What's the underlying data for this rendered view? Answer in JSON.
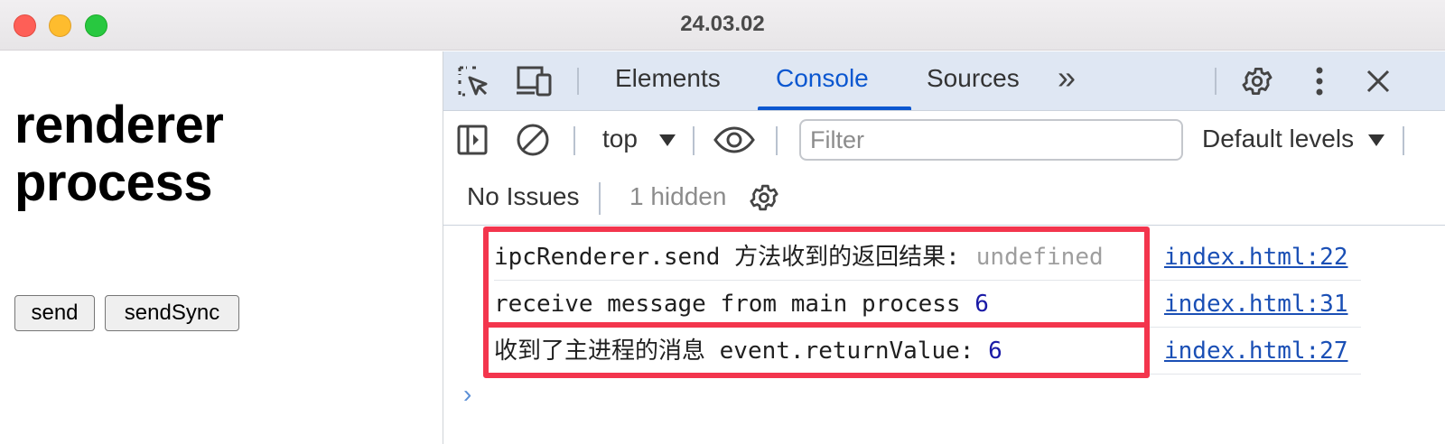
{
  "window": {
    "title": "24.03.02"
  },
  "page": {
    "heading": "renderer process",
    "buttons": {
      "send": "send",
      "send_sync": "sendSync"
    }
  },
  "devtools": {
    "tabs": [
      {
        "label": "Elements",
        "active": false
      },
      {
        "label": "Console",
        "active": true
      },
      {
        "label": "Sources",
        "active": false
      }
    ],
    "more_tabs_glyph": "»",
    "toolbar": {
      "context": "top",
      "filter_placeholder": "Filter",
      "levels": "Default levels"
    },
    "issues": {
      "status": "No Issues",
      "hidden": "1 hidden"
    },
    "messages": [
      {
        "text": "ipcRenderer.send 方法收到的返回结果:",
        "value": "undefined",
        "source": "index.html:22"
      },
      {
        "text": "receive message from main process",
        "value": "6",
        "source": "index.html:31"
      },
      {
        "text": "收到了主进程的消息 event.returnValue:",
        "value": "6",
        "source": "index.html:27"
      }
    ],
    "prompt_glyph": "›"
  },
  "colors": {
    "accent": "#0b57d0",
    "highlight_border": "#f3354d",
    "number": "#1a1aa6",
    "link": "#1a4fb5"
  }
}
